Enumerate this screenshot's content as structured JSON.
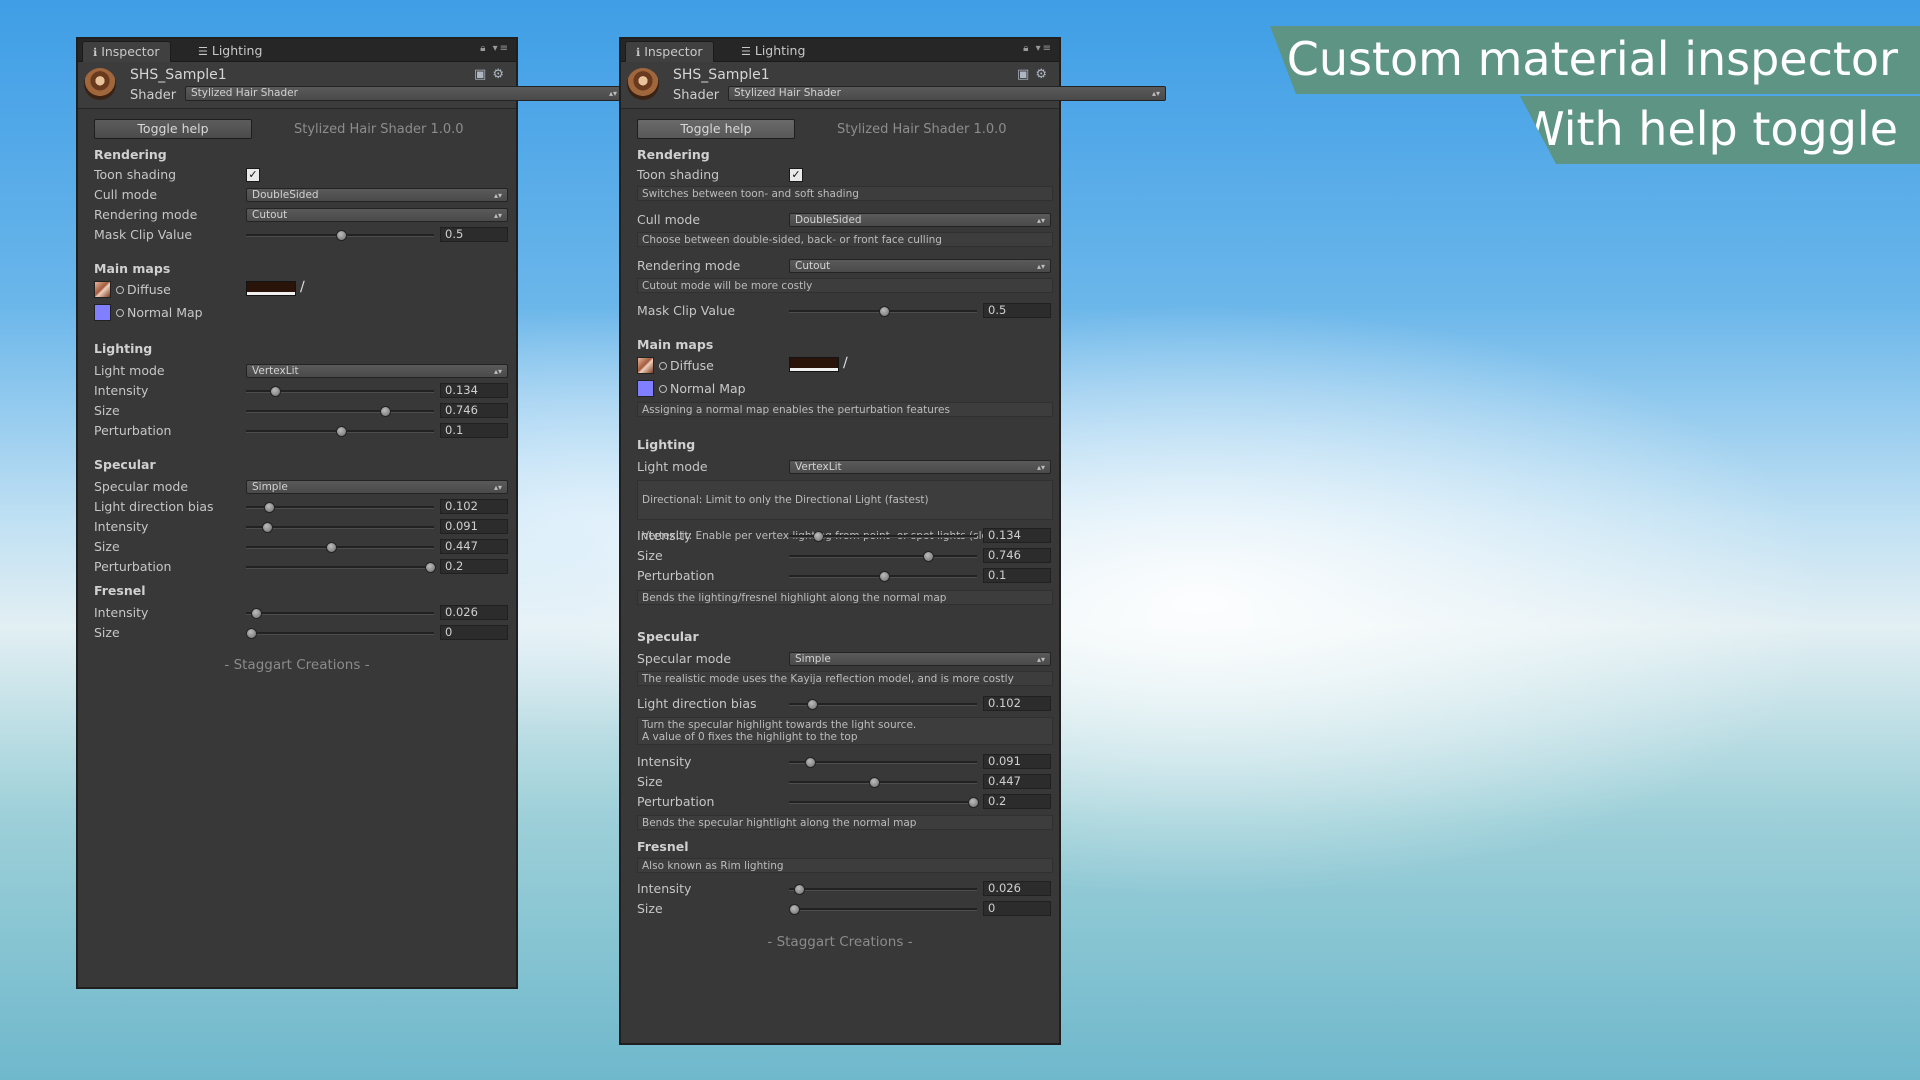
{
  "tabs": {
    "inspector": "Inspector",
    "lighting": "Lighting",
    "controls": "a ▾≡"
  },
  "material": {
    "name": "SHS_Sample1",
    "shader_label": "Shader",
    "shader_value": "Stylized Hair Shader"
  },
  "toggle_help": "Toggle help",
  "version": "Stylized Hair Shader 1.0.0",
  "sections": {
    "rendering": "Rendering",
    "main_maps": "Main maps",
    "lighting": "Lighting",
    "specular": "Specular",
    "fresnel": "Fresnel"
  },
  "labels": {
    "toon_shading": "Toon shading",
    "cull_mode": "Cull mode",
    "rendering_mode": "Rendering mode",
    "mask_clip": "Mask Clip Value",
    "diffuse": "Diffuse",
    "normal_map": "Normal Map",
    "light_mode": "Light mode",
    "intensity": "Intensity",
    "size": "Size",
    "perturbation": "Perturbation",
    "specular_mode": "Specular mode",
    "light_dir_bias": "Light direction bias"
  },
  "values": {
    "cull_mode": "DoubleSided",
    "rendering_mode": "Cutout",
    "mask_clip": "0.5",
    "light_mode": "VertexLit",
    "lighting_intensity": "0.134",
    "lighting_size": "0.746",
    "lighting_perturbation": "0.1",
    "specular_mode": "Simple",
    "light_dir_bias": "0.102",
    "specular_intensity": "0.091",
    "specular_size": "0.447",
    "specular_perturbation": "0.2",
    "fresnel_intensity": "0.026",
    "fresnel_size": "0"
  },
  "slider_fractions": {
    "mask_clip": 0.5,
    "lighting_intensity": 0.134,
    "lighting_size": 0.746,
    "lighting_perturbation": 0.5,
    "light_dir_bias": 0.102,
    "specular_intensity": 0.091,
    "specular_size": 0.447,
    "specular_perturbation": 1.0,
    "fresnel_intensity": 0.026,
    "fresnel_size": 0.0
  },
  "help": {
    "toon_shading": "Switches between toon- and soft shading",
    "cull_mode": "Choose between double-sided, back- or front face culling",
    "rendering_mode": "Cutout mode will be more costly",
    "normal_map": "Assigning a normal map enables the perturbation features",
    "light_mode_directional": "Directional: Limit to only the Directional Light (fastest)",
    "light_mode_vertexlit": "VertexLit: Enable per vertex lighting from point- or spot lights (slowest)",
    "lighting_perturbation": "Bends the lighting/fresnel highlight along the normal map",
    "specular_mode": "The realistic mode uses the Kayija reflection model, and is more costly",
    "light_dir_bias": "Turn the specular highlight towards the light source.\nA value of 0 fixes the highlight to the top",
    "specular_perturbation": "Bends the specular hightlight along the normal map",
    "fresnel": "Also known as Rim lighting"
  },
  "credits": "- Staggart Creations -",
  "banner": {
    "line1": "Custom material inspector",
    "line2": "With help toggle"
  }
}
